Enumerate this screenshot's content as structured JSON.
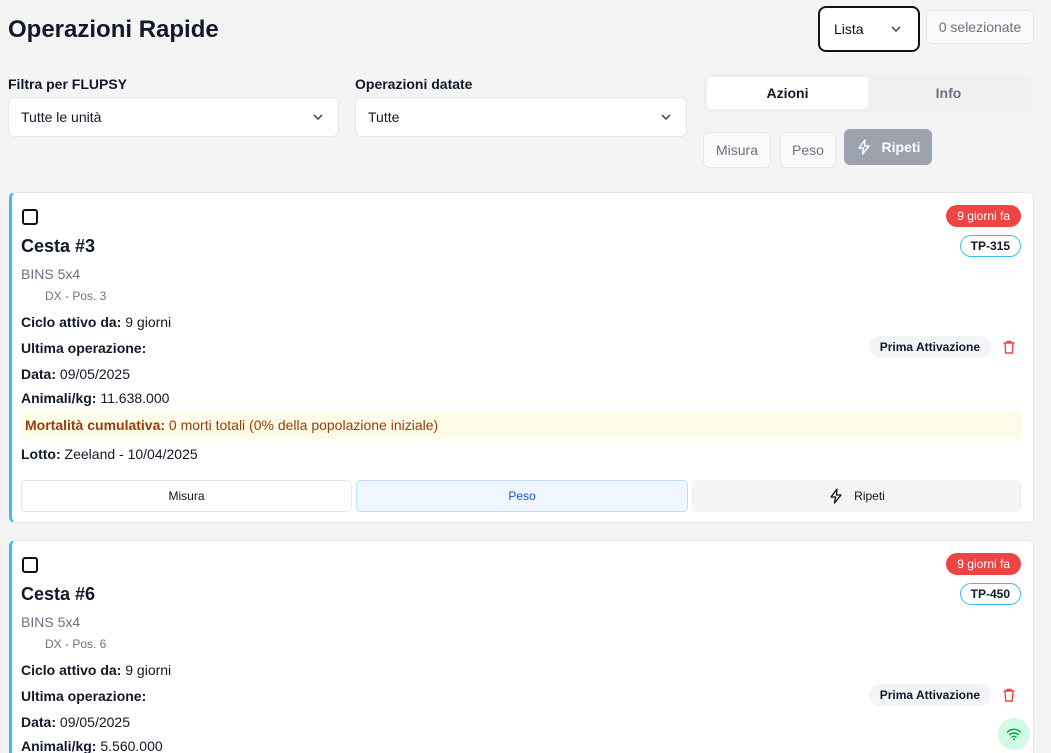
{
  "header": {
    "title": "Operazioni Rapide",
    "view_mode": "Lista",
    "selected_count": "0 selezionate"
  },
  "filters": {
    "flupsy_label": "Filtra per FLUPSY",
    "flupsy_value": "Tutte le unità",
    "dated_label": "Operazioni datate",
    "dated_value": "Tutte"
  },
  "tabs": {
    "actions": "Azioni",
    "info": "Info"
  },
  "bulk_actions": {
    "misura": "Misura",
    "peso": "Peso",
    "ripeti": "Ripeti"
  },
  "cards": [
    {
      "age": "9 giorni fa",
      "tag": "TP-315",
      "title": "Cesta #3",
      "type": "BINS 5x4",
      "position": "DX - Pos. 3",
      "cycle_label": "Ciclo attivo da:",
      "cycle_value": "9 giorni",
      "last_op_label": "Ultima operazione:",
      "last_op_value": "Prima Attivazione",
      "date_label": "Data:",
      "date_value": "09/05/2025",
      "animals_label": "Animali/kg:",
      "animals_value": "11.638.000",
      "mortality_label": "Mortalità cumulativa:",
      "mortality_value": "0 morti totali (0% della popolazione iniziale)",
      "lot_label": "Lotto:",
      "lot_value": "Zeeland - 10/04/2025",
      "btn_misura": "Misura",
      "btn_peso": "Peso",
      "btn_ripeti": "Ripeti"
    },
    {
      "age": "9 giorni fa",
      "tag": "TP-450",
      "title": "Cesta #6",
      "type": "BINS 5x4",
      "position": "DX - Pos. 6",
      "cycle_label": "Ciclo attivo da:",
      "cycle_value": "9 giorni",
      "last_op_label": "Ultima operazione:",
      "last_op_value": "Prima Attivazione",
      "date_label": "Data:",
      "date_value": "09/05/2025",
      "animals_label": "Animali/kg:",
      "animals_value": "5.560.000"
    }
  ],
  "colors": {
    "accent_border": "#38bdf8",
    "age_badge": "#ef4444",
    "delete": "#ef4444",
    "peso_button": "#eff6ff",
    "mortality_bg": "#fefce8"
  },
  "icons": [
    "chevron-down-icon",
    "lightning-icon",
    "trash-icon",
    "wifi-icon"
  ]
}
